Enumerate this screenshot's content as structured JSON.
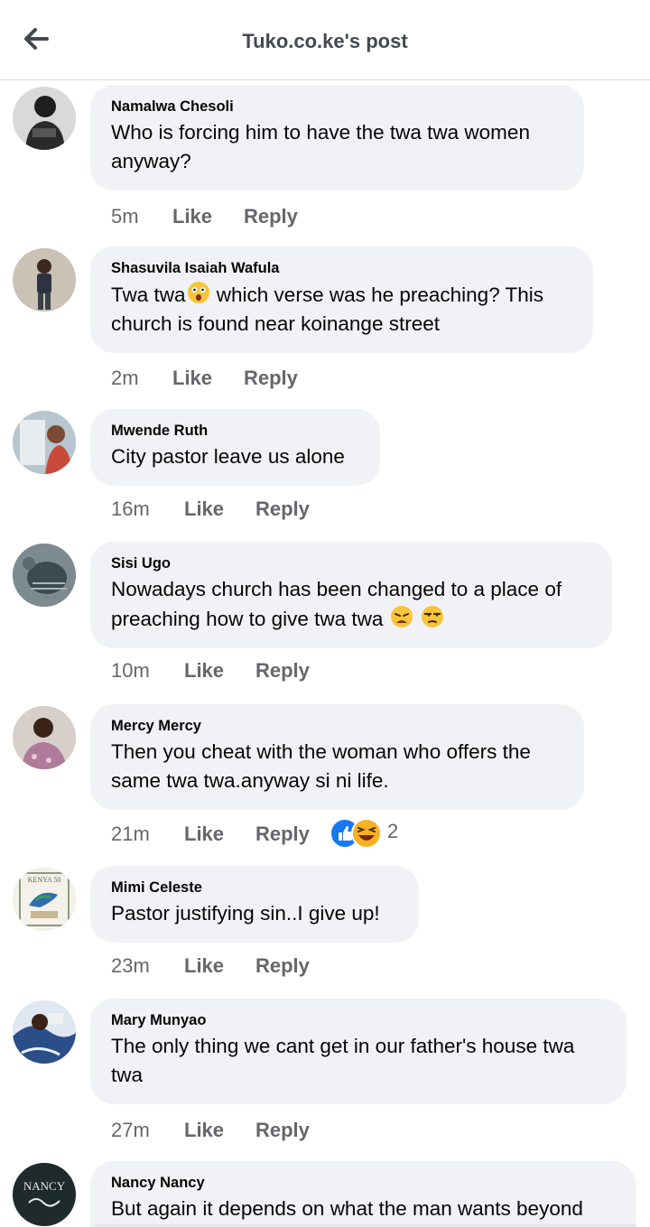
{
  "header": {
    "title": "Tuko.co.ke's post",
    "back_icon": "arrow-left-icon"
  },
  "actions": {
    "like": "Like",
    "reply": "Reply"
  },
  "colors": {
    "bubble": "#f0f2f5",
    "meta_text": "#65676b",
    "like_blue": "#1877f2",
    "haha_yellow": "#f7b125"
  },
  "comments": [
    {
      "author": "Namalwa Chesoli",
      "text": "Who is forcing him to have the twa twa women anyway?",
      "time": "5m"
    },
    {
      "author": "Shasuvila Isaiah Wafula",
      "text_before": "Twa twa",
      "emoji": "astonished-face-emoji",
      "text_after": " which verse was he preaching? This church is found near koinange street",
      "time": "2m"
    },
    {
      "author": "Mwende Ruth",
      "text": "City pastor leave us alone",
      "time": "16m"
    },
    {
      "author": "Sisi Ugo",
      "text": "Nowadays church has been changed to a place of preaching how to give twa twa ",
      "emojis": [
        "weary-face-emoji",
        "unamused-face-emoji"
      ],
      "time": "10m"
    },
    {
      "author": "Mercy Mercy",
      "text": "Then you cheat with the woman who offers the same twa twa.anyway si ni life.",
      "time": "21m",
      "reactions": {
        "icons": [
          "like-reaction-icon",
          "haha-reaction-icon"
        ],
        "count": "2"
      }
    },
    {
      "author": "Mimi Celeste",
      "text": "Pastor justifying sin..I give up!",
      "time": "23m",
      "avatar_text": "KENYA 50"
    },
    {
      "author": "Mary Munyao",
      "text": "The only thing we cant get in our father's house twa twa",
      "time": "27m"
    },
    {
      "author": "Nancy Nancy",
      "text": "But again it depends on what the man wants beyond",
      "avatar_text": "NANCY"
    }
  ]
}
